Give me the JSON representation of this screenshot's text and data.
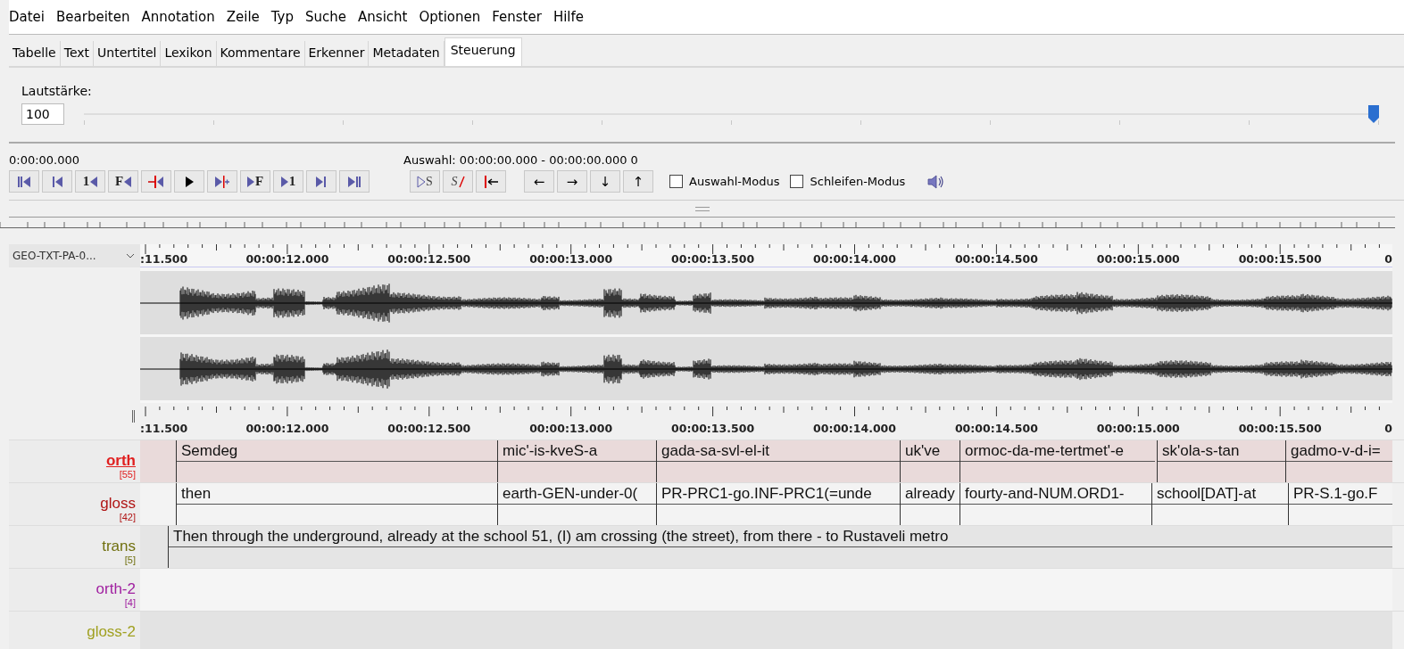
{
  "menu": [
    "Datei",
    "Bearbeiten",
    "Annotation",
    "Zeile",
    "Typ",
    "Suche",
    "Ansicht",
    "Optionen",
    "Fenster",
    "Hilfe"
  ],
  "tabs": [
    {
      "label": "Tabelle",
      "selected": false
    },
    {
      "label": "Text",
      "selected": false
    },
    {
      "label": "Untertitel",
      "selected": false
    },
    {
      "label": "Lexikon",
      "selected": false
    },
    {
      "label": "Kommentare",
      "selected": false
    },
    {
      "label": "Erkenner",
      "selected": false
    },
    {
      "label": "Metadaten",
      "selected": false
    },
    {
      "label": "Steuerung",
      "selected": true
    }
  ],
  "volume": {
    "label": "Lautstärke:",
    "value": "100",
    "level": 1
  },
  "transport": {
    "time": "0:00:00.000",
    "selection": "Auswahl: 00:00:00.000 - 00:00:00.000  0",
    "buttons": [
      {
        "kind": "double-bar-left"
      },
      {
        "kind": "bar-left"
      },
      {
        "kind": "label-left",
        "label": "1"
      },
      {
        "kind": "label-left",
        "label": "F"
      },
      {
        "kind": "red-left"
      },
      {
        "kind": "play"
      },
      {
        "kind": "play-red"
      },
      {
        "kind": "right-label",
        "label": "F"
      },
      {
        "kind": "right-label",
        "label": "1"
      },
      {
        "kind": "bar-right"
      },
      {
        "kind": "double-bar-right"
      }
    ],
    "selection_buttons": [
      {
        "kind": "outline-label",
        "label": "S"
      },
      {
        "kind": "struck-label",
        "label": "S"
      },
      {
        "kind": "red-arrow"
      }
    ],
    "arrow_buttons": [
      "←",
      "→",
      "↓",
      "↑"
    ],
    "modes": [
      {
        "label": "Auswahl-Modus",
        "checked": false
      },
      {
        "label": "Schleifen-Modus",
        "checked": false
      }
    ]
  },
  "waveform": {
    "track": "GEO-TXT-PA-0...",
    "ruler": [
      ":11.500",
      "00:00:12.000",
      "00:00:12.500",
      "00:00:13.000",
      "00:00:13.500",
      "00:00:14.000",
      "00:00:14.500",
      "00:00:15.000",
      "00:00:15.500",
      "0"
    ]
  },
  "timeline": {
    "ruler": [
      ":11.500",
      "00:00:12.000",
      "00:00:12.500",
      "00:00:13.000",
      "00:00:13.500",
      "00:00:14.000",
      "00:00:14.500",
      "00:00:15.000",
      "00:00:15.500",
      "0"
    ],
    "tiers": [
      {
        "name": "orth",
        "count": "[55]",
        "color": "#e02020",
        "active": true,
        "annotations": [
          "Semdeg",
          "mic'-is-kveS-a",
          "gada-sa-svl-el-it",
          "uk've",
          "ormoc-da-me-tertmet'-e",
          "sk'ola-s-tan",
          "gadmo-v-d-i="
        ]
      },
      {
        "name": "gloss",
        "count": "[42]",
        "color": "#b01515",
        "active": false,
        "annotations": [
          "then",
          "earth-GEN-under-0(",
          "PR-PRC1-go.INF-PRC1(=unde",
          "already",
          "fourty-and-NUM.ORD1-",
          "school[DAT]-at",
          "PR-S.1-go.F"
        ]
      },
      {
        "name": "trans",
        "count": "[5]",
        "color": "#70700f",
        "active": false,
        "annotations": [
          "Then through the underground, already at the school 51, (I) am crossing (the street), from there - to Rustaveli metro"
        ]
      },
      {
        "name": "orth-2",
        "count": "[4]",
        "color": "#a020a0",
        "active": false
      },
      {
        "name": "gloss-2",
        "color": "#a0a020",
        "active": false
      }
    ]
  }
}
